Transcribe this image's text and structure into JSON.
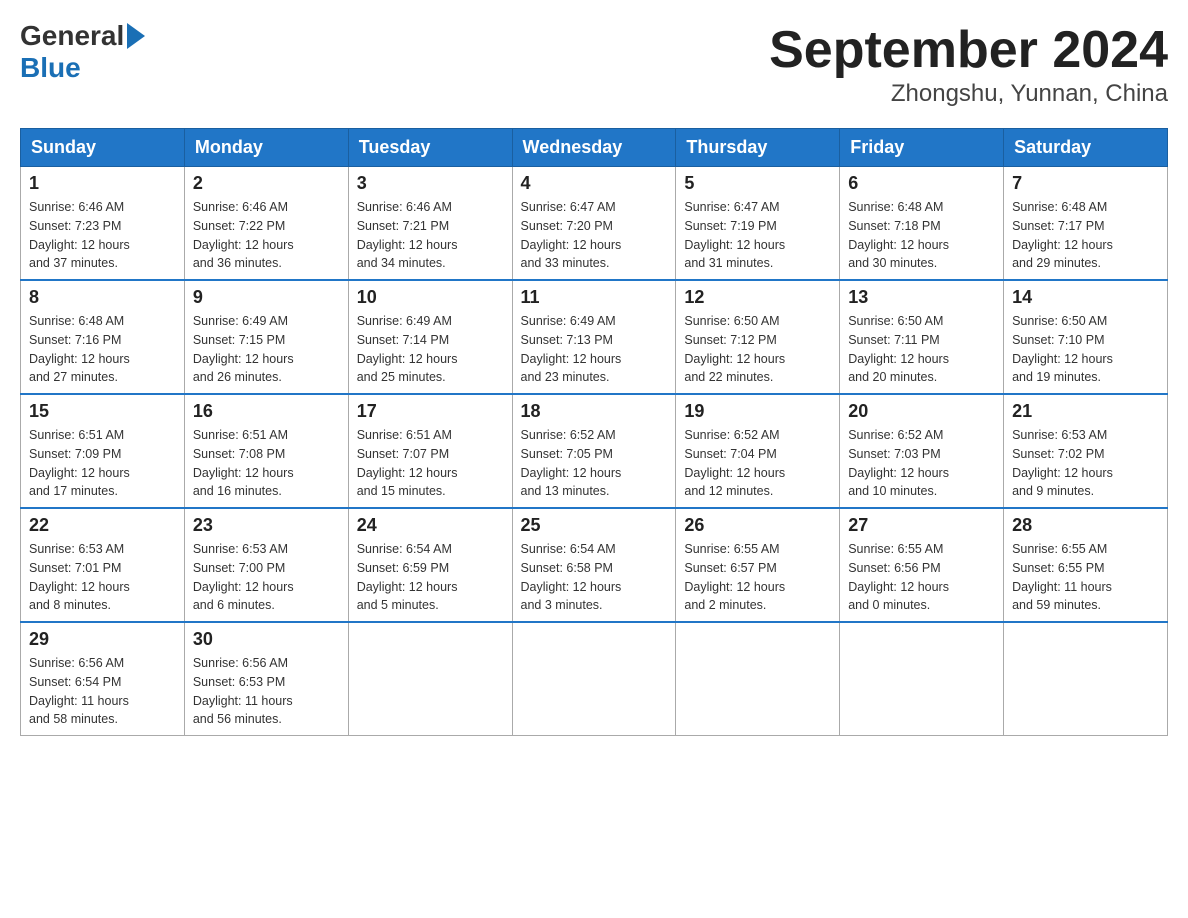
{
  "header": {
    "logo": {
      "general": "General",
      "blue": "Blue"
    },
    "title": "September 2024",
    "subtitle": "Zhongshu, Yunnan, China"
  },
  "weekdays": [
    "Sunday",
    "Monday",
    "Tuesday",
    "Wednesday",
    "Thursday",
    "Friday",
    "Saturday"
  ],
  "weeks": [
    [
      {
        "day": "1",
        "sunrise": "6:46 AM",
        "sunset": "7:23 PM",
        "daylight": "12 hours and 37 minutes."
      },
      {
        "day": "2",
        "sunrise": "6:46 AM",
        "sunset": "7:22 PM",
        "daylight": "12 hours and 36 minutes."
      },
      {
        "day": "3",
        "sunrise": "6:46 AM",
        "sunset": "7:21 PM",
        "daylight": "12 hours and 34 minutes."
      },
      {
        "day": "4",
        "sunrise": "6:47 AM",
        "sunset": "7:20 PM",
        "daylight": "12 hours and 33 minutes."
      },
      {
        "day": "5",
        "sunrise": "6:47 AM",
        "sunset": "7:19 PM",
        "daylight": "12 hours and 31 minutes."
      },
      {
        "day": "6",
        "sunrise": "6:48 AM",
        "sunset": "7:18 PM",
        "daylight": "12 hours and 30 minutes."
      },
      {
        "day": "7",
        "sunrise": "6:48 AM",
        "sunset": "7:17 PM",
        "daylight": "12 hours and 29 minutes."
      }
    ],
    [
      {
        "day": "8",
        "sunrise": "6:48 AM",
        "sunset": "7:16 PM",
        "daylight": "12 hours and 27 minutes."
      },
      {
        "day": "9",
        "sunrise": "6:49 AM",
        "sunset": "7:15 PM",
        "daylight": "12 hours and 26 minutes."
      },
      {
        "day": "10",
        "sunrise": "6:49 AM",
        "sunset": "7:14 PM",
        "daylight": "12 hours and 25 minutes."
      },
      {
        "day": "11",
        "sunrise": "6:49 AM",
        "sunset": "7:13 PM",
        "daylight": "12 hours and 23 minutes."
      },
      {
        "day": "12",
        "sunrise": "6:50 AM",
        "sunset": "7:12 PM",
        "daylight": "12 hours and 22 minutes."
      },
      {
        "day": "13",
        "sunrise": "6:50 AM",
        "sunset": "7:11 PM",
        "daylight": "12 hours and 20 minutes."
      },
      {
        "day": "14",
        "sunrise": "6:50 AM",
        "sunset": "7:10 PM",
        "daylight": "12 hours and 19 minutes."
      }
    ],
    [
      {
        "day": "15",
        "sunrise": "6:51 AM",
        "sunset": "7:09 PM",
        "daylight": "12 hours and 17 minutes."
      },
      {
        "day": "16",
        "sunrise": "6:51 AM",
        "sunset": "7:08 PM",
        "daylight": "12 hours and 16 minutes."
      },
      {
        "day": "17",
        "sunrise": "6:51 AM",
        "sunset": "7:07 PM",
        "daylight": "12 hours and 15 minutes."
      },
      {
        "day": "18",
        "sunrise": "6:52 AM",
        "sunset": "7:05 PM",
        "daylight": "12 hours and 13 minutes."
      },
      {
        "day": "19",
        "sunrise": "6:52 AM",
        "sunset": "7:04 PM",
        "daylight": "12 hours and 12 minutes."
      },
      {
        "day": "20",
        "sunrise": "6:52 AM",
        "sunset": "7:03 PM",
        "daylight": "12 hours and 10 minutes."
      },
      {
        "day": "21",
        "sunrise": "6:53 AM",
        "sunset": "7:02 PM",
        "daylight": "12 hours and 9 minutes."
      }
    ],
    [
      {
        "day": "22",
        "sunrise": "6:53 AM",
        "sunset": "7:01 PM",
        "daylight": "12 hours and 8 minutes."
      },
      {
        "day": "23",
        "sunrise": "6:53 AM",
        "sunset": "7:00 PM",
        "daylight": "12 hours and 6 minutes."
      },
      {
        "day": "24",
        "sunrise": "6:54 AM",
        "sunset": "6:59 PM",
        "daylight": "12 hours and 5 minutes."
      },
      {
        "day": "25",
        "sunrise": "6:54 AM",
        "sunset": "6:58 PM",
        "daylight": "12 hours and 3 minutes."
      },
      {
        "day": "26",
        "sunrise": "6:55 AM",
        "sunset": "6:57 PM",
        "daylight": "12 hours and 2 minutes."
      },
      {
        "day": "27",
        "sunrise": "6:55 AM",
        "sunset": "6:56 PM",
        "daylight": "12 hours and 0 minutes."
      },
      {
        "day": "28",
        "sunrise": "6:55 AM",
        "sunset": "6:55 PM",
        "daylight": "11 hours and 59 minutes."
      }
    ],
    [
      {
        "day": "29",
        "sunrise": "6:56 AM",
        "sunset": "6:54 PM",
        "daylight": "11 hours and 58 minutes."
      },
      {
        "day": "30",
        "sunrise": "6:56 AM",
        "sunset": "6:53 PM",
        "daylight": "11 hours and 56 minutes."
      },
      null,
      null,
      null,
      null,
      null
    ]
  ]
}
